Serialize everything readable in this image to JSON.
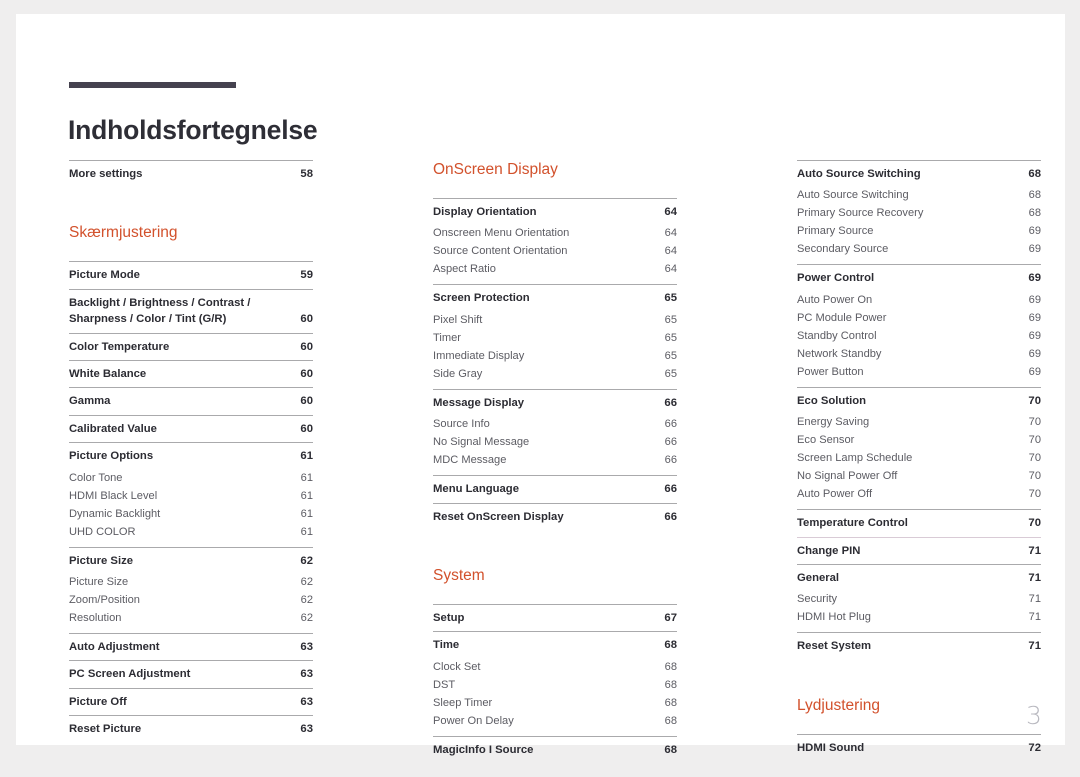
{
  "document": {
    "title": "Indholdsfortegnelse",
    "folio": "3",
    "accent_color": "#d2512c",
    "title_rule_color": "#45424f",
    "rule_color": "#aaaaac"
  },
  "columns": [
    {
      "name": "column-1",
      "blocks": [
        {
          "type": "group",
          "rows": [
            {
              "label": "More settings",
              "page": "58",
              "level": "main"
            }
          ]
        },
        {
          "type": "gap",
          "size": "section"
        },
        {
          "type": "heading",
          "text": "Skærmjustering"
        },
        {
          "type": "group",
          "rows": [
            {
              "label": "Picture Mode",
              "page": "59",
              "level": "main"
            }
          ]
        },
        {
          "type": "group",
          "rows": [
            {
              "label": "Backlight / Brightness / Contrast / Sharpness / Color / Tint (G/R)",
              "page": "60",
              "level": "main",
              "wrap": true
            }
          ]
        },
        {
          "type": "group",
          "rows": [
            {
              "label": "Color Temperature",
              "page": "60",
              "level": "main"
            }
          ]
        },
        {
          "type": "group",
          "rows": [
            {
              "label": "White Balance",
              "page": "60",
              "level": "main"
            }
          ]
        },
        {
          "type": "group",
          "rows": [
            {
              "label": "Gamma",
              "page": "60",
              "level": "main"
            }
          ]
        },
        {
          "type": "group",
          "rows": [
            {
              "label": "Calibrated Value",
              "page": "60",
              "level": "main"
            }
          ]
        },
        {
          "type": "group",
          "rows": [
            {
              "label": "Picture Options",
              "page": "61",
              "level": "main"
            },
            {
              "label": "Color Tone",
              "page": "61",
              "level": "sub"
            },
            {
              "label": "HDMI Black Level",
              "page": "61",
              "level": "sub"
            },
            {
              "label": "Dynamic Backlight",
              "page": "61",
              "level": "sub"
            },
            {
              "label": "UHD COLOR",
              "page": "61",
              "level": "sub"
            }
          ]
        },
        {
          "type": "group",
          "rows": [
            {
              "label": "Picture Size",
              "page": "62",
              "level": "main"
            },
            {
              "label": "Picture Size",
              "page": "62",
              "level": "sub"
            },
            {
              "label": "Zoom/Position",
              "page": "62",
              "level": "sub"
            },
            {
              "label": "Resolution",
              "page": "62",
              "level": "sub"
            }
          ]
        },
        {
          "type": "group",
          "rows": [
            {
              "label": "Auto Adjustment",
              "page": "63",
              "level": "main"
            }
          ]
        },
        {
          "type": "group",
          "rows": [
            {
              "label": "PC Screen Adjustment",
              "page": "63",
              "level": "main"
            }
          ]
        },
        {
          "type": "group",
          "rows": [
            {
              "label": "Picture Off",
              "page": "63",
              "level": "main"
            }
          ]
        },
        {
          "type": "group",
          "rows": [
            {
              "label": "Reset Picture",
              "page": "63",
              "level": "main"
            }
          ]
        }
      ]
    },
    {
      "name": "column-2",
      "blocks": [
        {
          "type": "heading",
          "text": "OnScreen Display"
        },
        {
          "type": "group",
          "rows": [
            {
              "label": "Display Orientation",
              "page": "64",
              "level": "main"
            },
            {
              "label": "Onscreen Menu Orientation",
              "page": "64",
              "level": "sub"
            },
            {
              "label": "Source Content Orientation",
              "page": "64",
              "level": "sub"
            },
            {
              "label": "Aspect Ratio",
              "page": "64",
              "level": "sub"
            }
          ]
        },
        {
          "type": "group",
          "rows": [
            {
              "label": "Screen Protection",
              "page": "65",
              "level": "main"
            },
            {
              "label": "Pixel Shift",
              "page": "65",
              "level": "sub"
            },
            {
              "label": "Timer",
              "page": "65",
              "level": "sub"
            },
            {
              "label": "Immediate Display",
              "page": "65",
              "level": "sub"
            },
            {
              "label": "Side Gray",
              "page": "65",
              "level": "sub"
            }
          ]
        },
        {
          "type": "group",
          "rows": [
            {
              "label": "Message Display",
              "page": "66",
              "level": "main"
            },
            {
              "label": "Source Info",
              "page": "66",
              "level": "sub"
            },
            {
              "label": "No Signal Message",
              "page": "66",
              "level": "sub"
            },
            {
              "label": "MDC Message",
              "page": "66",
              "level": "sub"
            }
          ]
        },
        {
          "type": "group",
          "rows": [
            {
              "label": "Menu Language",
              "page": "66",
              "level": "main"
            }
          ]
        },
        {
          "type": "group",
          "rows": [
            {
              "label": "Reset OnScreen Display",
              "page": "66",
              "level": "main"
            }
          ]
        },
        {
          "type": "gap",
          "size": "section"
        },
        {
          "type": "heading",
          "text": "System"
        },
        {
          "type": "group",
          "rows": [
            {
              "label": "Setup",
              "page": "67",
              "level": "main"
            }
          ]
        },
        {
          "type": "group",
          "rows": [
            {
              "label": "Time",
              "page": "68",
              "level": "main"
            },
            {
              "label": "Clock Set",
              "page": "68",
              "level": "sub"
            },
            {
              "label": "DST",
              "page": "68",
              "level": "sub"
            },
            {
              "label": "Sleep Timer",
              "page": "68",
              "level": "sub"
            },
            {
              "label": "Power On Delay",
              "page": "68",
              "level": "sub"
            }
          ]
        },
        {
          "type": "group",
          "rows": [
            {
              "label": "MagicInfo I Source",
              "page": "68",
              "level": "main"
            }
          ]
        }
      ]
    },
    {
      "name": "column-3",
      "blocks": [
        {
          "type": "group",
          "rows": [
            {
              "label": "Auto Source Switching",
              "page": "68",
              "level": "main"
            },
            {
              "label": "Auto Source Switching",
              "page": "68",
              "level": "sub"
            },
            {
              "label": "Primary Source Recovery",
              "page": "68",
              "level": "sub"
            },
            {
              "label": "Primary Source",
              "page": "69",
              "level": "sub"
            },
            {
              "label": "Secondary Source",
              "page": "69",
              "level": "sub"
            }
          ]
        },
        {
          "type": "group",
          "rows": [
            {
              "label": "Power Control",
              "page": "69",
              "level": "main"
            },
            {
              "label": "Auto Power On",
              "page": "69",
              "level": "sub"
            },
            {
              "label": "PC Module Power",
              "page": "69",
              "level": "sub"
            },
            {
              "label": "Standby Control",
              "page": "69",
              "level": "sub"
            },
            {
              "label": "Network Standby",
              "page": "69",
              "level": "sub"
            },
            {
              "label": "Power Button",
              "page": "69",
              "level": "sub"
            }
          ]
        },
        {
          "type": "group",
          "rows": [
            {
              "label": "Eco Solution",
              "page": "70",
              "level": "main"
            },
            {
              "label": "Energy Saving",
              "page": "70",
              "level": "sub"
            },
            {
              "label": "Eco Sensor",
              "page": "70",
              "level": "sub"
            },
            {
              "label": "Screen Lamp Schedule",
              "page": "70",
              "level": "sub"
            },
            {
              "label": "No Signal Power Off",
              "page": "70",
              "level": "sub"
            },
            {
              "label": "Auto Power Off",
              "page": "70",
              "level": "sub"
            }
          ]
        },
        {
          "type": "group",
          "rows": [
            {
              "label": "Temperature Control",
              "page": "70",
              "level": "main"
            }
          ]
        },
        {
          "type": "group",
          "rule": "light",
          "rows": [
            {
              "label": "Change PIN",
              "page": "71",
              "level": "main"
            }
          ]
        },
        {
          "type": "group",
          "rows": [
            {
              "label": "General",
              "page": "71",
              "level": "main"
            },
            {
              "label": "Security",
              "page": "71",
              "level": "sub"
            },
            {
              "label": "HDMI Hot Plug",
              "page": "71",
              "level": "sub"
            }
          ]
        },
        {
          "type": "group",
          "rows": [
            {
              "label": "Reset System",
              "page": "71",
              "level": "main"
            }
          ]
        },
        {
          "type": "gap",
          "size": "section"
        },
        {
          "type": "heading",
          "text": "Lydjustering"
        },
        {
          "type": "group",
          "rows": [
            {
              "label": "HDMI Sound",
              "page": "72",
              "level": "main"
            }
          ]
        }
      ]
    }
  ]
}
